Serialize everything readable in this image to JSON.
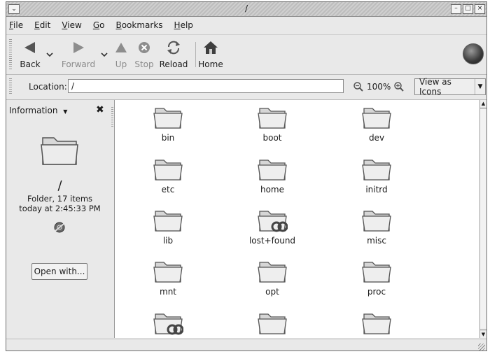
{
  "window": {
    "title": "/"
  },
  "menubar": [
    "File",
    "Edit",
    "View",
    "Go",
    "Bookmarks",
    "Help"
  ],
  "toolbar": {
    "back": "Back",
    "forward": "Forward",
    "up": "Up",
    "stop": "Stop",
    "reload": "Reload",
    "home": "Home"
  },
  "location": {
    "label": "Location:",
    "value": "/",
    "zoom": "100%",
    "view_as": "View as Icons"
  },
  "sidebar": {
    "header": "Information",
    "folder_name": "/",
    "summary": "Folder, 17 items",
    "modified": "today at 2:45:33 PM",
    "open_with": "Open with..."
  },
  "files": [
    {
      "name": "bin",
      "emblem": "none"
    },
    {
      "name": "boot",
      "emblem": "none"
    },
    {
      "name": "dev",
      "emblem": "none"
    },
    {
      "name": "etc",
      "emblem": "none"
    },
    {
      "name": "home",
      "emblem": "none"
    },
    {
      "name": "initrd",
      "emblem": "none"
    },
    {
      "name": "lib",
      "emblem": "none"
    },
    {
      "name": "lost+found",
      "emblem": "locked"
    },
    {
      "name": "misc",
      "emblem": "none"
    },
    {
      "name": "mnt",
      "emblem": "none"
    },
    {
      "name": "opt",
      "emblem": "none"
    },
    {
      "name": "proc",
      "emblem": "none"
    },
    {
      "name": "",
      "emblem": "locked"
    },
    {
      "name": "",
      "emblem": "none"
    },
    {
      "name": "",
      "emblem": "none"
    }
  ]
}
